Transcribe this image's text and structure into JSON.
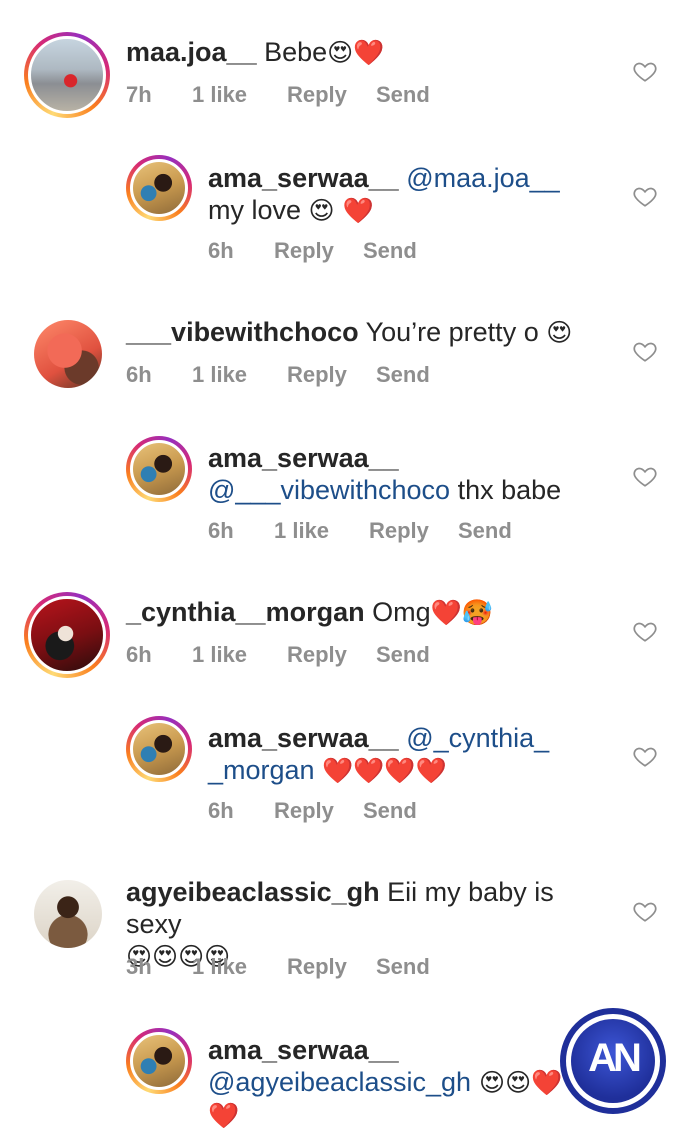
{
  "colors": {
    "text": "#262626",
    "meta": "#8e8e8e",
    "mention": "#1d4e89",
    "heart_red": "#e0242b",
    "story_ring": "#d62976",
    "watermark_blue": "#1f2f9a"
  },
  "comments": [
    {
      "username": "maa.joa__",
      "text": " Bebe",
      "emoji": "😍❤️",
      "time": "7h",
      "likes": "1 like",
      "reply_label": "Reply",
      "send_label": "Send",
      "like_icon": "heart-outline-icon"
    },
    {
      "username": "ama_serwaa__",
      "mention": "@maa.joa__",
      "text": " my love ",
      "emoji": "😍 ❤️",
      "time": "6h",
      "reply_label": "Reply",
      "send_label": "Send",
      "like_icon": "heart-outline-icon"
    },
    {
      "username": "___vibewithchoco",
      "text": " You’re pretty o ",
      "emoji": "😍",
      "time": "6h",
      "likes": "1 like",
      "reply_label": "Reply",
      "send_label": "Send",
      "like_icon": "heart-outline-icon"
    },
    {
      "username": "ama_serwaa__",
      "mention": "@___vibewithchoco",
      "text": " thx babe",
      "time": "6h",
      "likes": "1 like",
      "reply_label": "Reply",
      "send_label": "Send",
      "like_icon": "heart-outline-icon"
    },
    {
      "username": "_cynthia__morgan",
      "text": " Omg",
      "emoji": "❤️🥵",
      "time": "6h",
      "likes": "1 like",
      "reply_label": "Reply",
      "send_label": "Send",
      "like_icon": "heart-outline-icon"
    },
    {
      "username": "ama_serwaa__",
      "mention": "@_cynthia_ _morgan",
      "text": " ",
      "emoji": "❤️❤️❤️❤️",
      "time": "6h",
      "reply_label": "Reply",
      "send_label": "Send",
      "like_icon": "heart-outline-icon"
    },
    {
      "username": "agyeibeaclassic_gh",
      "text": " Eii my baby is sexy",
      "emoji": "😍😍😍😍",
      "time": "3h",
      "likes": "1 like",
      "reply_label": "Reply",
      "send_label": "Send",
      "like_icon": "heart-outline-icon"
    },
    {
      "username": "ama_serwaa__",
      "mention": "@agyeibeaclassic_gh",
      "emoji": " 😍😍❤️",
      "emoji_line2": "❤️"
    }
  ],
  "watermark": {
    "text": "AN"
  }
}
